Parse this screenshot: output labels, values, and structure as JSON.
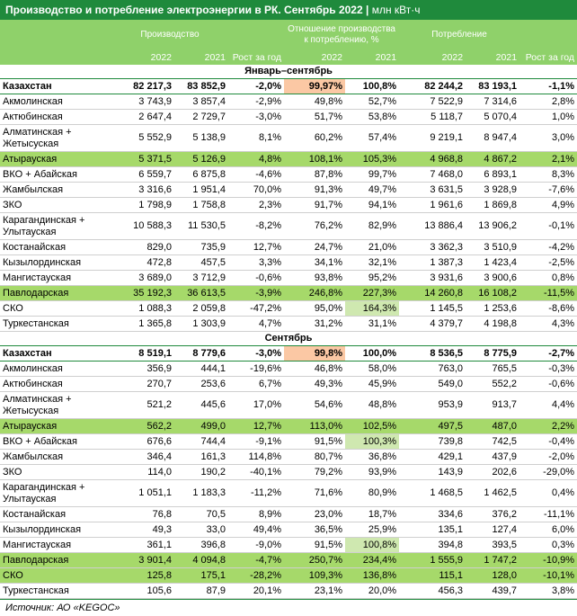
{
  "title": "Производство и потребление электроэнергии в РК. Сентябрь 2022",
  "unit": "млн кВт·ч",
  "headers": {
    "production": "Производство",
    "ratio": "Отношение производства к потреблению, %",
    "consumption": "Потребление",
    "growth": "Рост за год",
    "y2022": "2022",
    "y2021": "2021"
  },
  "sections": [
    {
      "label": "Январь–сентябрь",
      "rows": [
        {
          "name": "Казахстан",
          "p22": "82 217,3",
          "p21": "83 852,9",
          "pg": "-2,0%",
          "r22": "99,97%",
          "r21": "100,8%",
          "c22": "82 244,2",
          "c21": "83 193,1",
          "cg": "-1,1%",
          "type": "total",
          "hl": "r22",
          "hlc": "orange"
        },
        {
          "name": "Акмолинская",
          "p22": "3 743,9",
          "p21": "3 857,4",
          "pg": "-2,9%",
          "r22": "49,8%",
          "r21": "52,7%",
          "c22": "7 522,9",
          "c21": "7 314,6",
          "cg": "2,8%"
        },
        {
          "name": "Актюбинская",
          "p22": "2 647,4",
          "p21": "2 729,7",
          "pg": "-3,0%",
          "r22": "51,7%",
          "r21": "53,8%",
          "c22": "5 118,7",
          "c21": "5 070,4",
          "cg": "1,0%"
        },
        {
          "name": "Алматинская + Жетысуская",
          "p22": "5 552,9",
          "p21": "5 138,9",
          "pg": "8,1%",
          "r22": "60,2%",
          "r21": "57,4%",
          "c22": "9 219,1",
          "c21": "8 947,4",
          "cg": "3,0%",
          "tall": true
        },
        {
          "name": "Атырауская",
          "p22": "5 371,5",
          "p21": "5 126,9",
          "pg": "4,8%",
          "r22": "108,1%",
          "r21": "105,3%",
          "c22": "4 968,8",
          "c21": "4 867,2",
          "cg": "2,1%",
          "type": "green"
        },
        {
          "name": "ВКО + Абайская",
          "p22": "6 559,7",
          "p21": "6 875,8",
          "pg": "-4,6%",
          "r22": "87,8%",
          "r21": "99,7%",
          "c22": "7 468,0",
          "c21": "6 893,1",
          "cg": "8,3%"
        },
        {
          "name": "Жамбылская",
          "p22": "3 316,6",
          "p21": "1 951,4",
          "pg": "70,0%",
          "r22": "91,3%",
          "r21": "49,7%",
          "c22": "3 631,5",
          "c21": "3 928,9",
          "cg": "-7,6%"
        },
        {
          "name": "ЗКО",
          "p22": "1 798,9",
          "p21": "1 758,8",
          "pg": "2,3%",
          "r22": "91,7%",
          "r21": "94,1%",
          "c22": "1 961,6",
          "c21": "1 869,8",
          "cg": "4,9%"
        },
        {
          "name": "Карагандинская + Улытауская",
          "p22": "10 588,3",
          "p21": "11 530,5",
          "pg": "-8,2%",
          "r22": "76,2%",
          "r21": "82,9%",
          "c22": "13 886,4",
          "c21": "13 906,2",
          "cg": "-0,1%",
          "tall": true
        },
        {
          "name": "Костанайская",
          "p22": "829,0",
          "p21": "735,9",
          "pg": "12,7%",
          "r22": "24,7%",
          "r21": "21,0%",
          "c22": "3 362,3",
          "c21": "3 510,9",
          "cg": "-4,2%"
        },
        {
          "name": "Кызылординская",
          "p22": "472,8",
          "p21": "457,5",
          "pg": "3,3%",
          "r22": "34,1%",
          "r21": "32,1%",
          "c22": "1 387,3",
          "c21": "1 423,4",
          "cg": "-2,5%"
        },
        {
          "name": "Мангистауская",
          "p22": "3 689,0",
          "p21": "3 712,9",
          "pg": "-0,6%",
          "r22": "93,8%",
          "r21": "95,2%",
          "c22": "3 931,6",
          "c21": "3 900,6",
          "cg": "0,8%"
        },
        {
          "name": "Павлодарская",
          "p22": "35 192,3",
          "p21": "36 613,5",
          "pg": "-3,9%",
          "r22": "246,8%",
          "r21": "227,3%",
          "c22": "14 260,8",
          "c21": "16 108,2",
          "cg": "-11,5%",
          "type": "green"
        },
        {
          "name": "СКО",
          "p22": "1 088,3",
          "p21": "2 059,8",
          "pg": "-47,2%",
          "r22": "95,0%",
          "r21": "164,3%",
          "c22": "1 145,5",
          "c21": "1 253,6",
          "cg": "-8,6%",
          "hl": "r21",
          "hlc": "green"
        },
        {
          "name": "Туркестанская",
          "p22": "1 365,8",
          "p21": "1 303,9",
          "pg": "4,7%",
          "r22": "31,2%",
          "r21": "31,1%",
          "c22": "4 379,7",
          "c21": "4 198,8",
          "cg": "4,3%"
        }
      ]
    },
    {
      "label": "Сентябрь",
      "rows": [
        {
          "name": "Казахстан",
          "p22": "8 519,1",
          "p21": "8 779,6",
          "pg": "-3,0%",
          "r22": "99,8%",
          "r21": "100,0%",
          "c22": "8 536,5",
          "c21": "8 775,9",
          "cg": "-2,7%",
          "type": "total",
          "hl": "r22",
          "hlc": "orange"
        },
        {
          "name": "Акмолинская",
          "p22": "356,9",
          "p21": "444,1",
          "pg": "-19,6%",
          "r22": "46,8%",
          "r21": "58,0%",
          "c22": "763,0",
          "c21": "765,5",
          "cg": "-0,3%"
        },
        {
          "name": "Актюбинская",
          "p22": "270,7",
          "p21": "253,6",
          "pg": "6,7%",
          "r22": "49,3%",
          "r21": "45,9%",
          "c22": "549,0",
          "c21": "552,2",
          "cg": "-0,6%"
        },
        {
          "name": "Алматинская + Жетысуская",
          "p22": "521,2",
          "p21": "445,6",
          "pg": "17,0%",
          "r22": "54,6%",
          "r21": "48,8%",
          "c22": "953,9",
          "c21": "913,7",
          "cg": "4,4%",
          "tall": true
        },
        {
          "name": "Атырауская",
          "p22": "562,2",
          "p21": "499,0",
          "pg": "12,7%",
          "r22": "113,0%",
          "r21": "102,5%",
          "c22": "497,5",
          "c21": "487,0",
          "cg": "2,2%",
          "type": "green"
        },
        {
          "name": "ВКО + Абайская",
          "p22": "676,6",
          "p21": "744,4",
          "pg": "-9,1%",
          "r22": "91,5%",
          "r21": "100,3%",
          "c22": "739,8",
          "c21": "742,5",
          "cg": "-0,4%",
          "hl": "r21",
          "hlc": "green"
        },
        {
          "name": "Жамбылская",
          "p22": "346,4",
          "p21": "161,3",
          "pg": "114,8%",
          "r22": "80,7%",
          "r21": "36,8%",
          "c22": "429,1",
          "c21": "437,9",
          "cg": "-2,0%"
        },
        {
          "name": "ЗКО",
          "p22": "114,0",
          "p21": "190,2",
          "pg": "-40,1%",
          "r22": "79,2%",
          "r21": "93,9%",
          "c22": "143,9",
          "c21": "202,6",
          "cg": "-29,0%"
        },
        {
          "name": "Карагандинская + Улытауская",
          "p22": "1 051,1",
          "p21": "1 183,3",
          "pg": "-11,2%",
          "r22": "71,6%",
          "r21": "80,9%",
          "c22": "1 468,5",
          "c21": "1 462,5",
          "cg": "0,4%",
          "tall": true
        },
        {
          "name": "Костанайская",
          "p22": "76,8",
          "p21": "70,5",
          "pg": "8,9%",
          "r22": "23,0%",
          "r21": "18,7%",
          "c22": "334,6",
          "c21": "376,2",
          "cg": "-11,1%"
        },
        {
          "name": "Кызылординская",
          "p22": "49,3",
          "p21": "33,0",
          "pg": "49,4%",
          "r22": "36,5%",
          "r21": "25,9%",
          "c22": "135,1",
          "c21": "127,4",
          "cg": "6,0%"
        },
        {
          "name": "Мангистауская",
          "p22": "361,1",
          "p21": "396,8",
          "pg": "-9,0%",
          "r22": "91,5%",
          "r21": "100,8%",
          "c22": "394,8",
          "c21": "393,5",
          "cg": "0,3%",
          "hl": "r21",
          "hlc": "green"
        },
        {
          "name": "Павлодарская",
          "p22": "3 901,4",
          "p21": "4 094,8",
          "pg": "-4,7%",
          "r22": "250,7%",
          "r21": "234,4%",
          "c22": "1 555,9",
          "c21": "1 747,2",
          "cg": "-10,9%",
          "type": "green"
        },
        {
          "name": "СКО",
          "p22": "125,8",
          "p21": "175,1",
          "pg": "-28,2%",
          "r22": "109,3%",
          "r21": "136,8%",
          "c22": "115,1",
          "c21": "128,0",
          "cg": "-10,1%",
          "type": "green"
        },
        {
          "name": "Туркестанская",
          "p22": "105,6",
          "p21": "87,9",
          "pg": "20,1%",
          "r22": "23,1%",
          "r21": "20,0%",
          "c22": "456,3",
          "c21": "439,7",
          "cg": "3,8%"
        }
      ]
    }
  ],
  "source": "Источник: АО «KEGOC»",
  "chart_data": {
    "type": "table",
    "title": "Производство и потребление электроэнергии в РК. Сентябрь 2022",
    "columns": [
      "",
      "Производство 2022",
      "Производство 2021",
      "Рост за год",
      "Отношение 2022",
      "Отношение 2021",
      "Потребление 2022",
      "Потребление 2021",
      "Рост за год"
    ],
    "colors": {
      "header": "#8fd16a",
      "title": "#1f8a3c",
      "highlight_orange": "#fbc8a4",
      "highlight_green": "#cfe8b0",
      "row_green": "#a6d96a"
    }
  }
}
